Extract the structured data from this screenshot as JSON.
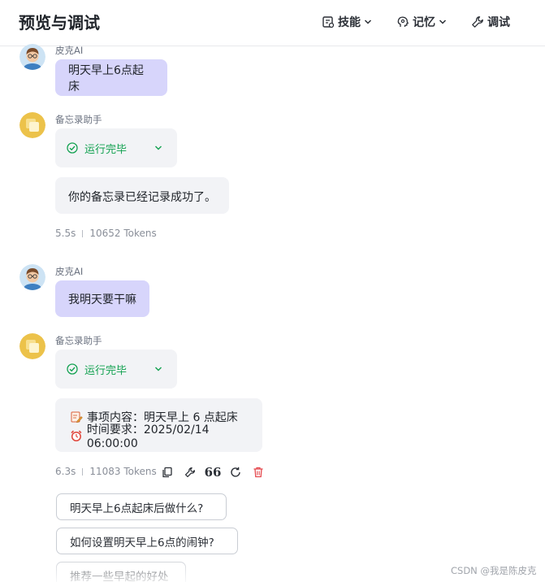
{
  "header": {
    "title": "预览与调试",
    "skills_label": "技能",
    "memory_label": "记忆",
    "debug_label": "调试"
  },
  "messages": {
    "user1": {
      "sender": "皮克AI",
      "text": "明天早上6点起床"
    },
    "bot1": {
      "sender": "备忘录助手",
      "status": "运行完毕",
      "reply": "你的备忘录已经记录成功了。",
      "time": "5.5s",
      "tokens": "10652 Tokens"
    },
    "user2": {
      "sender": "皮克AI",
      "text": "我明天要干嘛"
    },
    "bot2": {
      "sender": "备忘录助手",
      "status": "运行完毕",
      "line1": "事项内容：明天早上 6 点起床",
      "line2": "时间要求：2025/02/14 06:00:00",
      "time": "6.3s",
      "tokens": "11083 Tokens"
    }
  },
  "actions": {
    "quote_glyph": "66"
  },
  "suggestions": [
    "明天早上6点起床后做什么?",
    "如何设置明天早上6点的闹钟?",
    "推荐一些早起的好处"
  ],
  "watermark": "CSDN @我是陈皮克",
  "colors": {
    "user_bubble": "#d7d5fb",
    "bot_bubble": "#f2f3f6",
    "status_green": "#12a150",
    "delete_red": "#e5484d"
  }
}
